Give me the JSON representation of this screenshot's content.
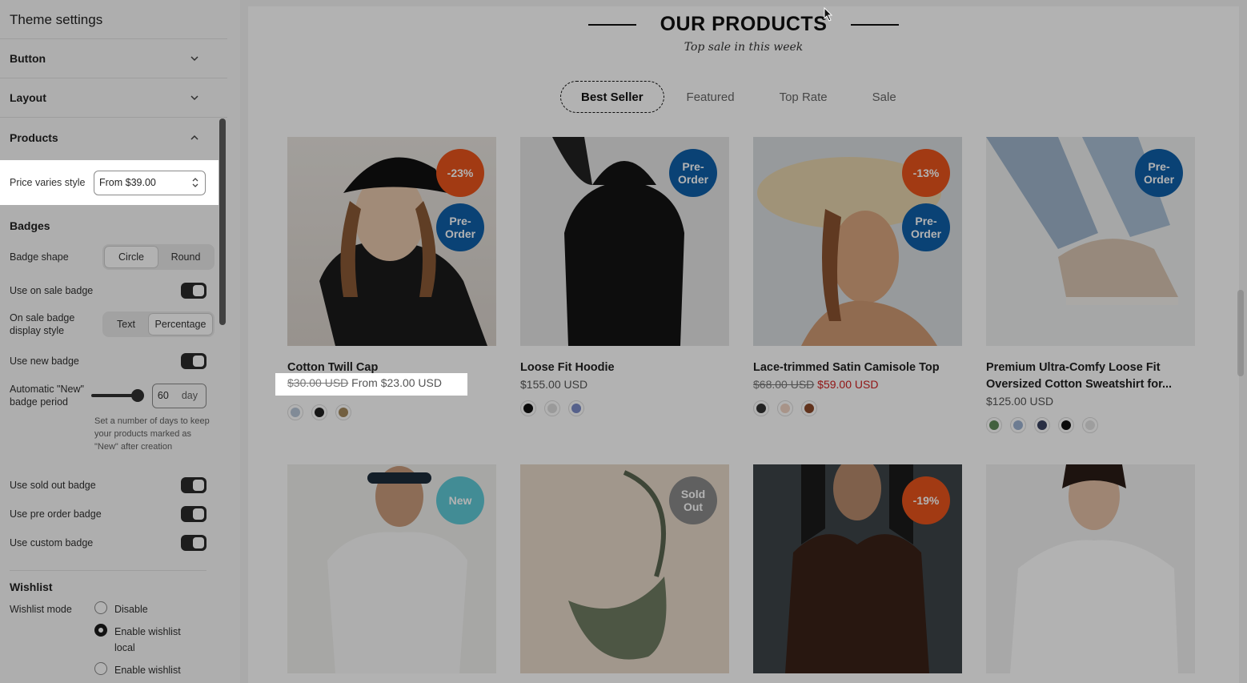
{
  "sidebar": {
    "title": "Theme settings",
    "sections": [
      {
        "label": "Button"
      },
      {
        "label": "Layout"
      },
      {
        "label": "Products"
      }
    ],
    "price_varies": {
      "label": "Price varies style",
      "value": "From $39.00"
    },
    "badges": {
      "heading": "Badges",
      "shape_label": "Badge shape",
      "shape_options": [
        "Circle",
        "Round"
      ],
      "use_on_sale": "Use on sale badge",
      "on_sale_style_label": "On sale badge display style",
      "on_sale_style_options": [
        "Text",
        "Percentage"
      ],
      "use_new": "Use new badge",
      "auto_new_label": "Automatic \"New\" badge period",
      "auto_new_value": "60",
      "auto_new_unit": "day",
      "auto_new_help": "Set a number of days to keep your products marked as \"New\" after creation",
      "use_sold_out": "Use sold out badge",
      "use_pre_order": "Use pre order badge",
      "use_custom": "Use custom badge"
    },
    "wishlist": {
      "heading": "Wishlist",
      "mode_label": "Wishlist mode",
      "options": [
        "Disable",
        "Enable wishlist local",
        "Enable wishlist"
      ]
    }
  },
  "preview": {
    "heading": "OUR PRODUCTS",
    "subheading": "Top sale in this week",
    "tabs": [
      "Best Seller",
      "Featured",
      "Top Rate",
      "Sale"
    ],
    "products": [
      {
        "name": "Cotton Twill Cap",
        "old_price": "$30.00 USD",
        "price": "From $23.00 USD",
        "badges": [
          "-23%",
          "Pre-\nOrder"
        ]
      },
      {
        "name": "Loose Fit Hoodie",
        "price": "$155.00 USD",
        "badges": [
          "Pre-\nOrder"
        ]
      },
      {
        "name": "Lace-trimmed Satin Camisole Top",
        "old_price": "$68.00 USD",
        "price": "$59.00 USD",
        "badges": [
          "-13%",
          "Pre-\nOrder"
        ]
      },
      {
        "name": "Premium Ultra-Comfy Loose Fit Oversized Cotton Sweatshirt for...",
        "price": "$125.00 USD",
        "badges": [
          "Pre-\nOrder"
        ]
      },
      {
        "name": "",
        "badges": [
          "New"
        ]
      },
      {
        "name": "",
        "badges": [
          "Sold\nOut"
        ]
      },
      {
        "name": "",
        "badges": [
          "-19%"
        ]
      },
      {
        "name": "",
        "badges": []
      }
    ]
  },
  "colors": {
    "badge_sale": "#e8541c",
    "badge_preorder": "#0f5fa8",
    "badge_new": "#5fc9d6",
    "badge_soldout": "#8a8a8a",
    "sale_price": "#d02020"
  }
}
